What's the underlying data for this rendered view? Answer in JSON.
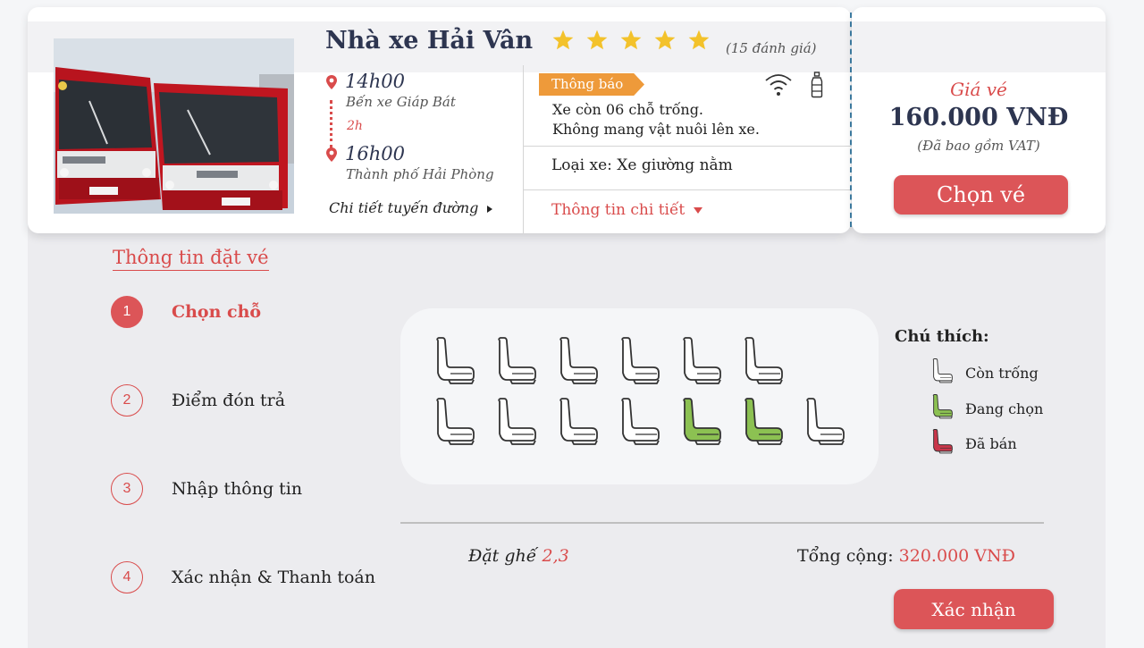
{
  "trip": {
    "operator": "Nhà xe Hải Vân",
    "rating_stars": 5,
    "review_count": "(15 đánh giá)",
    "depart_time": "14h00",
    "depart_place": "Bến xe Giáp Bát",
    "duration": "2h",
    "arrive_time": "16h00",
    "arrive_place": "Thành phố Hải Phòng",
    "route_link": "Chi tiết tuyến đường",
    "notice_tag": "Thông báo",
    "notice_line1": "Xe còn 06 chỗ trống.",
    "notice_line2": "Không mang vật nuôi lên xe.",
    "bus_type": "Loại xe: Xe giường nằm",
    "detail_link": "Thông tin chi tiết",
    "amenities": [
      "wifi-icon",
      "water-bottle-icon"
    ]
  },
  "price": {
    "label": "Giá vé",
    "value": "160.000 VNĐ",
    "vat_note": "(Đã bao gồm VAT)",
    "choose_button": "Chọn vé"
  },
  "booking": {
    "title": "Thông tin đặt vé",
    "steps": [
      {
        "num": "1",
        "label": "Chọn chỗ",
        "active": true
      },
      {
        "num": "2",
        "label": "Điểm đón trả",
        "active": false
      },
      {
        "num": "3",
        "label": "Nhập thông tin",
        "active": false
      },
      {
        "num": "4",
        "label": "Xác nhận & Thanh toán",
        "active": false
      }
    ]
  },
  "seats": {
    "rows": [
      [
        "available",
        "available",
        "available",
        "available",
        "available",
        "available"
      ],
      [
        "available",
        "available",
        "available",
        "available",
        "selected",
        "selected",
        "available"
      ]
    ]
  },
  "legend": {
    "title": "Chú thích:",
    "items": [
      {
        "state": "available",
        "label": "Còn trống"
      },
      {
        "state": "selected",
        "label": "Đang chọn"
      },
      {
        "state": "sold",
        "label": "Đã bán"
      }
    ]
  },
  "summary": {
    "seats_label": "Đặt ghế",
    "seats_value": "2,3",
    "total_label": "Tổng cộng:",
    "total_value": "320.000 VNĐ",
    "confirm_button": "Xác nhận"
  },
  "colors": {
    "accent_red": "#dc5558",
    "seat_available": "#ffffff",
    "seat_selected": "#8cc152",
    "seat_sold": "#c9364a",
    "notice_orange": "#ee9a3a",
    "title_navy": "#2d3550"
  }
}
